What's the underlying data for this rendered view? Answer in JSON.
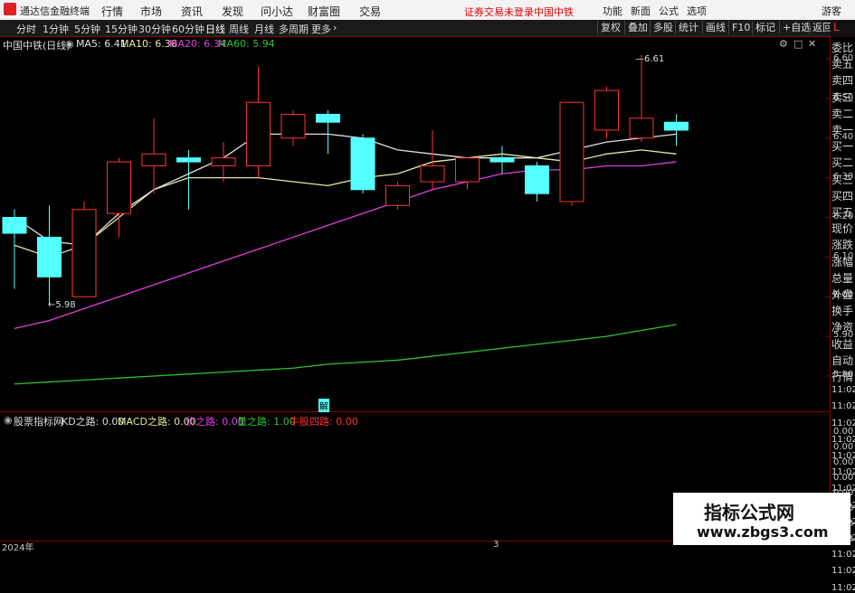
{
  "app": {
    "brand": "通达信金融终端",
    "menu": [
      "行情",
      "市场",
      "资讯",
      "发现",
      "问小达",
      "财富圈",
      "交易"
    ],
    "status_text": "证券交易未登录",
    "stock_short": "中国中铁",
    "right_menu": [
      "功能",
      "新面",
      "公式",
      "选项"
    ],
    "guest": "游客"
  },
  "toolbar": {
    "timeframes": [
      "分时",
      "1分钟",
      "5分钟",
      "15分钟",
      "30分钟",
      "60分钟",
      "日线",
      "周线",
      "月线",
      "多周期",
      "更多"
    ],
    "active": "日线",
    "buttons": [
      "复权",
      "叠加",
      "多股",
      "统计",
      "画线",
      "F10",
      "标记",
      "+自选",
      "返回"
    ]
  },
  "chart_info": {
    "title": "中国中铁(日线)",
    "ma5": "MA5: 6.41",
    "ma10": "MA10: 6.36",
    "ma20": "MA20: 6.34",
    "ma60": "MA60: 5.94",
    "high_label": "6.61",
    "low_label": "5.98",
    "colors": {
      "ma5": "#e0e0e0",
      "ma10": "#e8e8a0",
      "ma20": "#e040e0",
      "ma60": "#30c030",
      "up": "#ff3333",
      "down": "#54ffff"
    }
  },
  "price_axis": [
    "6.60",
    "6.50",
    "6.40",
    "6.30",
    "6.20",
    "6.10",
    "6.00",
    "5.90",
    "5.80"
  ],
  "right_panel": [
    "委比",
    "卖五",
    "卖四",
    "卖三",
    "卖二",
    "卖一",
    "买一",
    "买二",
    "买三",
    "买四",
    "买五",
    "现价",
    "涨跌",
    "涨幅",
    "总量",
    "外盘",
    "换手",
    "净资",
    "收益",
    "自动",
    "行情",
    "11:02",
    "11:02",
    "11:02",
    "11:02",
    "11:02",
    "11:02",
    "11:02",
    "11:02",
    "11:02",
    "11:02",
    "11:02",
    "11:02",
    "11:02"
  ],
  "indicator": {
    "name": "股票指标网",
    "kd": "KD之路: 0.00",
    "macd": "MACD之路: 0.00",
    "price": "价之路: 0.00",
    "volume": "量之路: 1.00",
    "bull": "牛股四路: 0.00",
    "axis": [
      "0.00",
      "0.00",
      "0.00",
      "0.00",
      "0.00",
      "0.00",
      "0.00",
      "0.00"
    ]
  },
  "time_axis": {
    "start": "2024年",
    "mid": "3"
  },
  "watermark": {
    "title": "指标公式网",
    "url": "www.zbgs3.com"
  },
  "chart_data": {
    "type": "candlestick",
    "ylim": [
      5.75,
      6.65
    ],
    "candles": [
      {
        "o": 6.2,
        "c": 6.16,
        "h": 6.22,
        "l": 6.02
      },
      {
        "o": 6.15,
        "c": 6.05,
        "h": 6.23,
        "l": 5.98
      },
      {
        "o": 6.0,
        "c": 6.22,
        "h": 6.24,
        "l": 6.0
      },
      {
        "o": 6.21,
        "c": 6.34,
        "h": 6.35,
        "l": 6.15
      },
      {
        "o": 6.33,
        "c": 6.36,
        "h": 6.45,
        "l": 6.26
      },
      {
        "o": 6.35,
        "c": 6.34,
        "h": 6.37,
        "l": 6.22
      },
      {
        "o": 6.33,
        "c": 6.35,
        "h": 6.39,
        "l": 6.29
      },
      {
        "o": 6.33,
        "c": 6.49,
        "h": 6.58,
        "l": 6.3
      },
      {
        "o": 6.4,
        "c": 6.46,
        "h": 6.47,
        "l": 6.38
      },
      {
        "o": 6.46,
        "c": 6.44,
        "h": 6.47,
        "l": 6.36
      },
      {
        "o": 6.4,
        "c": 6.27,
        "h": 6.41,
        "l": 6.26
      },
      {
        "o": 6.23,
        "c": 6.28,
        "h": 6.29,
        "l": 6.22
      },
      {
        "o": 6.29,
        "c": 6.33,
        "h": 6.42,
        "l": 6.27
      },
      {
        "o": 6.29,
        "c": 6.35,
        "h": 6.35,
        "l": 6.27
      },
      {
        "o": 6.35,
        "c": 6.34,
        "h": 6.38,
        "l": 6.31
      },
      {
        "o": 6.33,
        "c": 6.26,
        "h": 6.34,
        "l": 6.24
      },
      {
        "o": 6.24,
        "c": 6.49,
        "h": 6.49,
        "l": 6.23
      },
      {
        "o": 6.42,
        "c": 6.52,
        "h": 6.53,
        "l": 6.4
      },
      {
        "o": 6.4,
        "c": 6.45,
        "h": 6.61,
        "l": 6.39
      },
      {
        "o": 6.44,
        "c": 6.42,
        "h": 6.46,
        "l": 6.38
      }
    ],
    "ma5": [
      6.2,
      6.14,
      6.13,
      6.21,
      6.27,
      6.31,
      6.35,
      6.41,
      6.41,
      6.41,
      6.4,
      6.37,
      6.36,
      6.35,
      6.35,
      6.35,
      6.37,
      6.39,
      6.4,
      6.41
    ],
    "ma10": [
      6.13,
      6.1,
      6.13,
      6.2,
      6.27,
      6.3,
      6.3,
      6.3,
      6.29,
      6.28,
      6.3,
      6.31,
      6.34,
      6.35,
      6.36,
      6.35,
      6.34,
      6.36,
      6.37,
      6.36
    ],
    "ma20": [
      5.92,
      5.94,
      5.97,
      6.0,
      6.03,
      6.06,
      6.09,
      6.12,
      6.15,
      6.18,
      6.21,
      6.24,
      6.27,
      6.29,
      6.31,
      6.32,
      6.32,
      6.33,
      6.33,
      6.34
    ],
    "ma60": [
      5.78,
      5.785,
      5.79,
      5.795,
      5.8,
      5.805,
      5.81,
      5.815,
      5.82,
      5.83,
      5.835,
      5.84,
      5.85,
      5.86,
      5.87,
      5.88,
      5.89,
      5.9,
      5.915,
      5.93
    ]
  }
}
